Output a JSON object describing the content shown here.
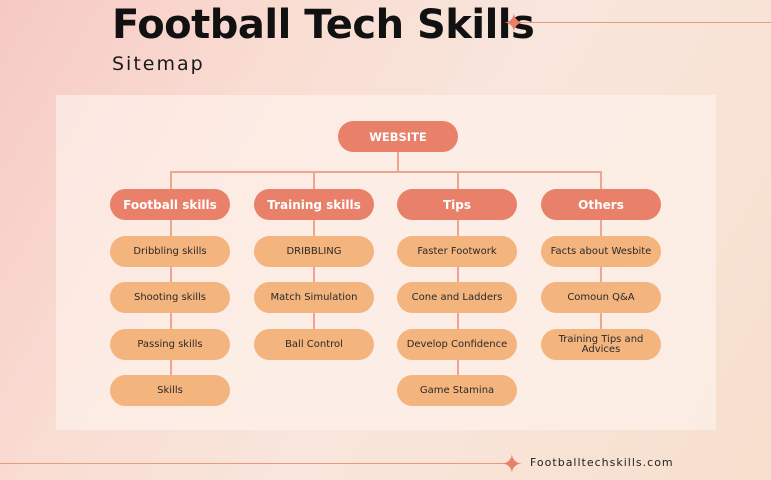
{
  "header": {
    "title": "Football Tech Skills",
    "subtitle": "Sitemap"
  },
  "footer": {
    "url": "Footballtechskills.com"
  },
  "sitemap": {
    "root": "WEBSITE",
    "categories": [
      {
        "label": "Football skills",
        "items": [
          "Dribbling skills",
          "Shooting skills",
          "Passing skills",
          "Skills"
        ]
      },
      {
        "label": "Training skills",
        "items": [
          "DRIBBLING",
          "Match Simulation",
          "Ball Control"
        ]
      },
      {
        "label": "Tips",
        "items": [
          "Faster Footwork",
          "Cone and Ladders",
          "Develop Confidence",
          "Game Stamina"
        ]
      },
      {
        "label": "Others",
        "items": [
          "Facts about Wesbite",
          "Comoun Q&A",
          "Training Tips and Advices"
        ]
      }
    ]
  },
  "colors": {
    "node_primary": "#e8806a",
    "node_secondary": "#f4b47e",
    "connector": "#f0a58e",
    "accent_star": "#e9806a"
  },
  "icons": {
    "decorative_star": "four-point-star-icon"
  }
}
